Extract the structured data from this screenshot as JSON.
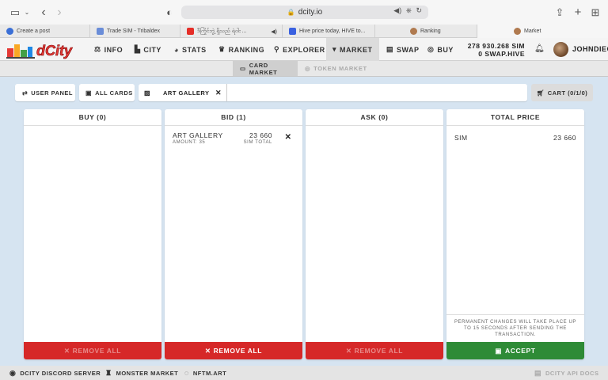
{
  "browser": {
    "url": "dcity.io",
    "tabs": [
      {
        "label": "Create a post",
        "fav_color": "#3b6fd6"
      },
      {
        "label": "Trade SIM - Tribaldex",
        "fav_color": "#6a8dd8"
      },
      {
        "label": "ဒီကြိုင်ဘွဲ့ ရှိသည် ရဲဝါး ...",
        "fav_color": "#e52d27"
      },
      {
        "label": "Hive price today, HIVE to...",
        "fav_color": "#3a61e0"
      },
      {
        "label": "Ranking",
        "fav_color": "#b07a4f"
      },
      {
        "label": "Market",
        "fav_color": "#b07a4f"
      }
    ]
  },
  "nav": {
    "logo": "dCity",
    "items": [
      {
        "label": "INFO",
        "icon": "scale-icon",
        "glyph": "⚖"
      },
      {
        "label": "CITY",
        "icon": "city-icon",
        "glyph": "▙"
      },
      {
        "label": "STATS",
        "icon": "chart-pie-icon",
        "glyph": "◕"
      },
      {
        "label": "RANKING",
        "icon": "trophy-icon",
        "glyph": "♛"
      },
      {
        "label": "EXPLORER",
        "icon": "search-icon",
        "glyph": "⚲"
      },
      {
        "label": "MARKET",
        "icon": "cart-icon",
        "glyph": "🛒"
      },
      {
        "label": "SWAP",
        "icon": "money-icon",
        "glyph": "▤"
      },
      {
        "label": "BUY",
        "icon": "coins-icon",
        "glyph": "◎"
      }
    ],
    "balance_sim": "278 930.268 SIM",
    "balance_swap": "0 SWAP.HIVE",
    "username": "JOHNDIEG"
  },
  "subnav": {
    "card_market": "CARD MARKET",
    "token_market": "TOKEN MARKET"
  },
  "filters": {
    "user_panel": "USER PANEL",
    "all_cards": "ALL CARDS",
    "selected_card": "ART GALLERY",
    "cart": "CART (0/1/0)"
  },
  "panels": {
    "buy": {
      "title": "BUY (0)",
      "button": "REMOVE ALL"
    },
    "bid": {
      "title": "BID (1)",
      "button": "REMOVE ALL",
      "rows": [
        {
          "name": "ART GALLERY",
          "amount": "AMOUNT: 35",
          "value": "23 660",
          "value_label": "SIM TOTAL"
        }
      ]
    },
    "ask": {
      "title": "ASK (0)",
      "button": "REMOVE ALL"
    },
    "total": {
      "title": "TOTAL PRICE",
      "currency": "SIM",
      "amount": "23 660",
      "note": "PERMANENT CHANGES WILL TAKE PLACE UP TO 15 SECONDS AFTER SENDING THE TRANSACTION.",
      "button": "ACCEPT"
    }
  },
  "footer": {
    "discord": "DCITY DISCORD SERVER",
    "monster": "MONSTER MARKET",
    "nftm": "NFTM.ART",
    "api": "DCITY API DOCS"
  },
  "colors": {
    "remove_red": "#d62828",
    "accept_green": "#2e8b36",
    "background": "#d6e4f1"
  }
}
